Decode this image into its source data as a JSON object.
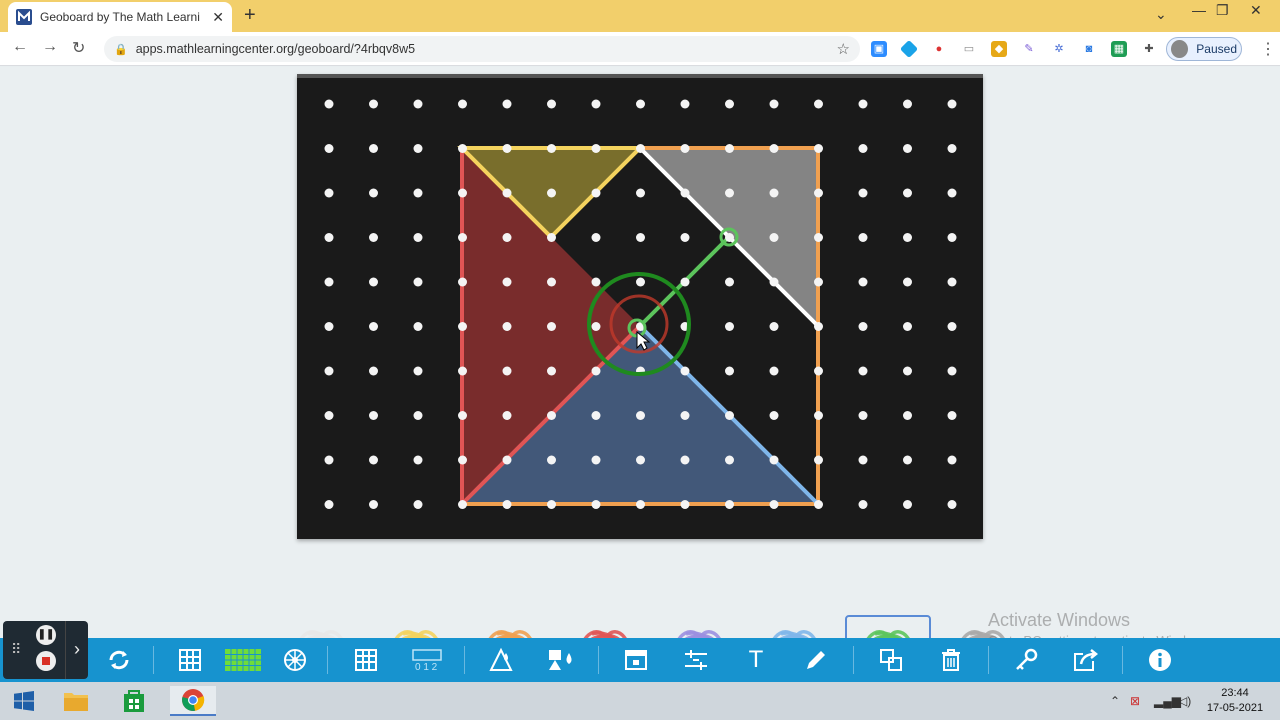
{
  "browser": {
    "tab_title": "Geoboard by The Math Learning",
    "tab_close": "✕",
    "new_tab": "+",
    "url": "apps.mathlearningcenter.org/geoboard/?4rbqv8w5",
    "profile_status": "Paused",
    "window_controls": [
      "⌄",
      "—",
      "❐",
      "✕"
    ]
  },
  "geoboard": {
    "selected_band_color": "green",
    "bands": [
      {
        "name": "white",
        "color": "#e8e8e8"
      },
      {
        "name": "yellow",
        "color": "#f4d35e"
      },
      {
        "name": "orange",
        "color": "#f0a050"
      },
      {
        "name": "red",
        "color": "#e05555"
      },
      {
        "name": "purple",
        "color": "#9b8fe0"
      },
      {
        "name": "blue",
        "color": "#7fb6ea"
      },
      {
        "name": "green",
        "color": "#5cc45c"
      },
      {
        "name": "gray",
        "color": "#a8a8a8"
      }
    ]
  },
  "toolbar": {
    "items": [
      {
        "name": "clear-icon",
        "glyph": "⟳"
      },
      {
        "name": "grid-icon",
        "glyph": "▦"
      },
      {
        "name": "dense-grid-icon",
        "glyph": "▩"
      },
      {
        "name": "circle-board-icon",
        "glyph": "✲"
      },
      {
        "name": "table-icon",
        "glyph": "▤"
      },
      {
        "name": "number-line-icon",
        "glyph": "012"
      },
      {
        "name": "fill-icon",
        "glyph": "◭"
      },
      {
        "name": "fill-color-icon",
        "glyph": "◈"
      },
      {
        "name": "screen-icon",
        "glyph": "⎚"
      },
      {
        "name": "measure-icon",
        "glyph": "⇹"
      },
      {
        "name": "text-icon",
        "glyph": "T"
      },
      {
        "name": "pen-icon",
        "glyph": "✎"
      },
      {
        "name": "duplicate-icon",
        "glyph": "⧉"
      },
      {
        "name": "trash-icon",
        "glyph": "🗑"
      },
      {
        "name": "key-icon",
        "glyph": "⚷"
      },
      {
        "name": "share-icon",
        "glyph": "⇪"
      },
      {
        "name": "info-icon",
        "glyph": "ℹ"
      }
    ],
    "accent": "#1793cf"
  },
  "watermark": {
    "line1": "Activate Windows",
    "line2": "Go to PC settings to activate Windows."
  },
  "taskbar": {
    "time": "23:44",
    "date": "17-05-2021"
  }
}
